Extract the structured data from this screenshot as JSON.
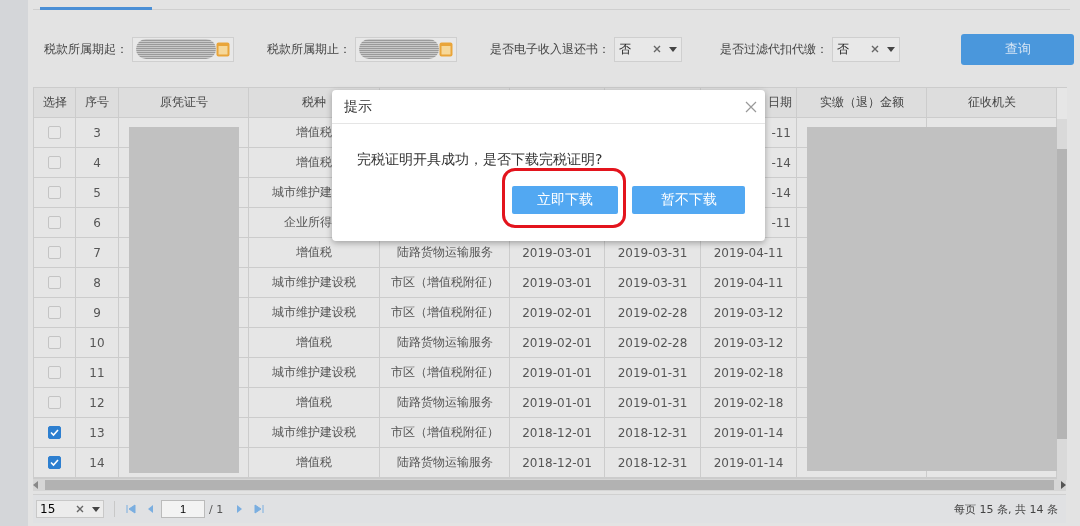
{
  "filters": [
    {
      "kind": "date",
      "label": "税款所属期起："
    },
    {
      "kind": "date",
      "label": "税款所属期止："
    },
    {
      "kind": "select",
      "label": "是否电子收入退还书：",
      "value": "否"
    },
    {
      "kind": "select",
      "label": "是否过滤代扣代缴：",
      "value": "否"
    }
  ],
  "query_button": "查询",
  "table": {
    "columns": [
      {
        "label": "选择"
      },
      {
        "label": "序号"
      },
      {
        "label": "原凭证号"
      },
      {
        "label": "税种"
      },
      {},
      {},
      {},
      {
        "label": "日期"
      },
      {
        "label": "实缴（退）金额"
      },
      {
        "label": "征收机关"
      }
    ],
    "rows": [
      {
        "checked": false,
        "no": "3",
        "tax": "增值税",
        "due": "-11"
      },
      {
        "checked": false,
        "no": "4",
        "tax": "增值税",
        "due": "-14"
      },
      {
        "checked": false,
        "no": "5",
        "tax": "城市维护建",
        "due": "-14"
      },
      {
        "checked": false,
        "no": "6",
        "tax": "企业所得",
        "due": "-11"
      },
      {
        "checked": false,
        "no": "7",
        "tax": "增值税",
        "item": "陆路货物运输服务",
        "start": "2019-03-01",
        "end": "2019-03-31",
        "due": "2019-04-11"
      },
      {
        "checked": false,
        "no": "8",
        "tax": "城市维护建设税",
        "item": "市区（增值税附征）",
        "start": "2019-03-01",
        "end": "2019-03-31",
        "due": "2019-04-11"
      },
      {
        "checked": false,
        "no": "9",
        "tax": "城市维护建设税",
        "item": "市区（增值税附征）",
        "start": "2019-02-01",
        "end": "2019-02-28",
        "due": "2019-03-12"
      },
      {
        "checked": false,
        "no": "10",
        "tax": "增值税",
        "item": "陆路货物运输服务",
        "start": "2019-02-01",
        "end": "2019-02-28",
        "due": "2019-03-12"
      },
      {
        "checked": false,
        "no": "11",
        "tax": "城市维护建设税",
        "item": "市区（增值税附征）",
        "start": "2019-01-01",
        "end": "2019-01-31",
        "due": "2019-02-18"
      },
      {
        "checked": false,
        "no": "12",
        "tax": "增值税",
        "item": "陆路货物运输服务",
        "start": "2019-01-01",
        "end": "2019-01-31",
        "due": "2019-02-18"
      },
      {
        "checked": true,
        "no": "13",
        "tax": "城市维护建设税",
        "item": "市区（增值税附征）",
        "start": "2018-12-01",
        "end": "2018-12-31",
        "due": "2019-01-14"
      },
      {
        "checked": true,
        "no": "14",
        "tax": "增值税",
        "item": "陆路货物运输服务",
        "start": "2018-12-01",
        "end": "2018-12-31",
        "due": "2019-01-14"
      }
    ]
  },
  "pager": {
    "page_size": "15",
    "page": "1",
    "total_pages": "/ 1",
    "summary": "每页 15 条, 共 14 条"
  },
  "dialog": {
    "title": "提示",
    "message": "完税证明开具成功，是否下载完税证明?",
    "buttons": [
      {
        "label": "立即下载",
        "highlighted": true
      },
      {
        "label": "暂不下载",
        "highlighted": false
      }
    ]
  }
}
